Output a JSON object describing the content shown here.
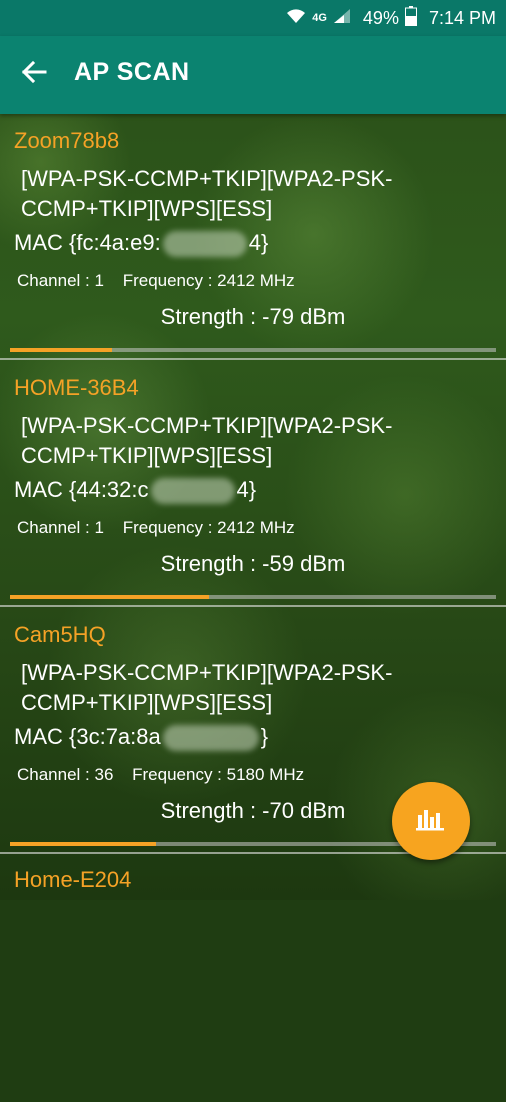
{
  "status_bar": {
    "network": "4G",
    "battery": "49%",
    "time": "7:14 PM"
  },
  "app_bar": {
    "title": "AP SCAN"
  },
  "colors": {
    "accent": "#f5a226",
    "toolbar": "#0b8370",
    "status": "#0a7868"
  },
  "access_points": [
    {
      "ssid": "Zoom78b8",
      "capabilities": "[WPA-PSK-CCMP+TKIP][WPA2-PSK-CCMP+TKIP][WPS][ESS]",
      "mac_prefix": "MAC {fc:4a:e9:",
      "mac_suffix": "4}",
      "channel": "Channel : 1",
      "frequency": "Frequency : 2412 MHz",
      "strength": "Strength : -79 dBm",
      "signal_level": 0.21
    },
    {
      "ssid": "HOME-36B4",
      "capabilities": "[WPA-PSK-CCMP+TKIP][WPA2-PSK-CCMP+TKIP][WPS][ESS]",
      "mac_prefix": "MAC {44:32:c",
      "mac_suffix": "4}",
      "channel": "Channel : 1",
      "frequency": "Frequency : 2412 MHz",
      "strength": "Strength : -59 dBm",
      "signal_level": 0.41
    },
    {
      "ssid": "Cam5HQ",
      "capabilities": "[WPA-PSK-CCMP+TKIP][WPA2-PSK-CCMP+TKIP][WPS][ESS]",
      "mac_prefix": "MAC {3c:7a:8a",
      "mac_suffix": "}",
      "channel": "Channel : 36",
      "frequency": "Frequency : 5180 MHz",
      "strength": "Strength : -70 dBm",
      "signal_level": 0.3
    },
    {
      "ssid": "Home-E204"
    }
  ],
  "fab": {
    "icon": "bar-chart-icon"
  }
}
